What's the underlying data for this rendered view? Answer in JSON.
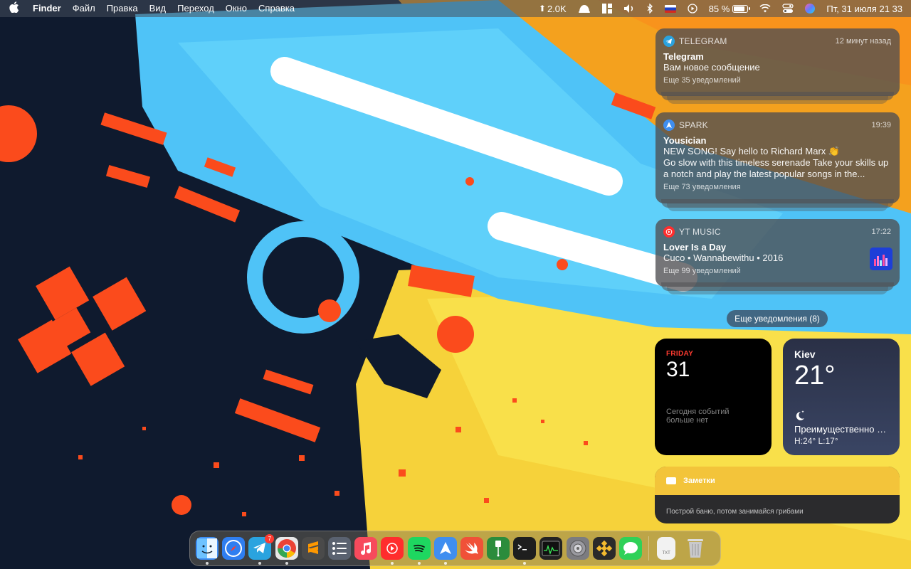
{
  "menubar": {
    "app_name": "Finder",
    "menus": [
      "Файл",
      "Правка",
      "Вид",
      "Переход",
      "Окно",
      "Справка"
    ],
    "network_speed": "2.0K",
    "battery_percent": "85 %",
    "battery_level": 0.85,
    "datetime": "Пт, 31 июля  21 33"
  },
  "notifications": [
    {
      "app": "TELEGRAM",
      "time": "12 минут назад",
      "title": "Telegram",
      "body": "Вам новое сообщение",
      "more": "Еще 35 уведомлений",
      "icon": "telegram-icon",
      "color": "#2aa3df"
    },
    {
      "app": "SPARK",
      "time": "19:39",
      "title": "Yousician",
      "body": "NEW SONG! Say hello to Richard Marx 👏",
      "body2": "Go slow with this timeless serenade Take your skills up a notch and play the latest popular songs in the...",
      "more": "Еще 73 уведомления",
      "icon": "spark-icon",
      "color": "#3f8ef0"
    },
    {
      "app": "YT MUSIC",
      "time": "17:22",
      "title": "Lover Is a Day",
      "body": "Cuco • Wannabewithu • 2016",
      "more": "Еще 99 уведомлений",
      "icon": "youtube-music-icon",
      "color": "#ff2d2d"
    }
  ],
  "show_more": "Еще уведомления (8)",
  "widgets": {
    "calendar": {
      "day": "FRIDAY",
      "date": "31",
      "no_events": "Сегодня событий больше нет"
    },
    "weather": {
      "city": "Kiev",
      "temp": "21°",
      "condition": "Преимущественно ясно",
      "high_low": "H:24° L:17°"
    },
    "notes": {
      "title": "Заметки",
      "note": "Построй баню, потом занимайся грибами"
    }
  },
  "dock": {
    "apps": [
      {
        "name": "finder",
        "color": "#3d8ef5",
        "running": true
      },
      {
        "name": "safari",
        "color": "#2f7ef0",
        "running": false
      },
      {
        "name": "telegram",
        "color": "#2aa3df",
        "running": true,
        "badge": "7"
      },
      {
        "name": "chrome",
        "color": "#e8e8e8",
        "running": true
      },
      {
        "name": "sublime-text",
        "color": "#4a4a4a",
        "running": false
      },
      {
        "name": "tasks",
        "color": "#5a6270",
        "running": false
      },
      {
        "name": "music",
        "color": "#f74a5c",
        "running": false
      },
      {
        "name": "youtube-music",
        "color": "#ff2d2d",
        "running": true
      },
      {
        "name": "spotify",
        "color": "#1ed760",
        "running": true
      },
      {
        "name": "spark",
        "color": "#3f8ef0",
        "running": true
      },
      {
        "name": "swift",
        "color": "#f05138",
        "running": false
      },
      {
        "name": "usb-app",
        "color": "#2b8c3c",
        "running": false
      },
      {
        "name": "terminal",
        "color": "#1e1e1e",
        "running": true
      },
      {
        "name": "activity-monitor",
        "color": "#222",
        "running": false
      },
      {
        "name": "system-preferences",
        "color": "#7c7c80",
        "running": false
      },
      {
        "name": "binance",
        "color": "#2a2a2a",
        "running": false
      },
      {
        "name": "messages",
        "color": "#2fd158",
        "running": false
      }
    ],
    "extras": [
      {
        "name": "text-document",
        "label": "TXT"
      },
      {
        "name": "trash"
      }
    ]
  }
}
